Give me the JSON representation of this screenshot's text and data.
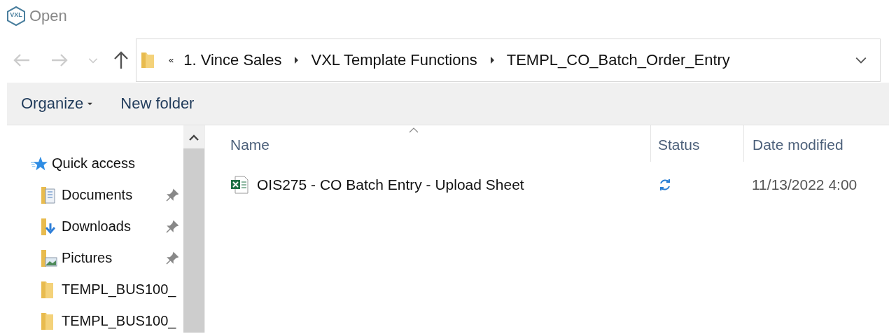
{
  "window": {
    "logo": "VXL",
    "title": "Open"
  },
  "nav": {
    "back_disabled": true,
    "forward_disabled": true
  },
  "breadcrumb": {
    "overflow": "«",
    "items": [
      "1. Vince Sales",
      "VXL Template Functions",
      "TEMPL_CO_Batch_Order_Entry"
    ]
  },
  "toolbar": {
    "organize": "Organize",
    "new_folder": "New folder"
  },
  "sidebar": {
    "items": [
      {
        "kind": "quick-access",
        "label": "Quick access",
        "pinned": false
      },
      {
        "kind": "documents",
        "label": "Documents",
        "pinned": true
      },
      {
        "kind": "downloads",
        "label": "Downloads",
        "pinned": true
      },
      {
        "kind": "pictures",
        "label": "Pictures",
        "pinned": true
      },
      {
        "kind": "folder",
        "label": "TEMPL_BUS100_",
        "pinned": false
      },
      {
        "kind": "folder",
        "label": "TEMPL_BUS100_",
        "pinned": false
      }
    ]
  },
  "table": {
    "columns": [
      "Name",
      "Status",
      "Date modified"
    ],
    "rows": [
      {
        "name": "OIS275 - CO Batch Entry - Upload Sheet",
        "syncing": true,
        "date_modified": "11/13/2022 4:00"
      }
    ]
  }
}
